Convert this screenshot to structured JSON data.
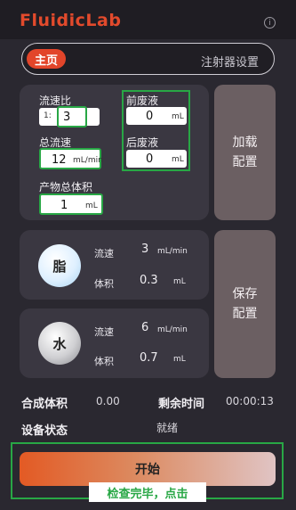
{
  "header": {
    "logo_text": "FluidicLab",
    "info_icon": "info-icon",
    "info_glyph": "i"
  },
  "tabs": {
    "main": "主页",
    "settings": "注射器设置"
  },
  "params": {
    "flow_ratio_label": "流速比",
    "flow_ratio_prefix": "1:",
    "flow_ratio_value": "3",
    "front_waste_label": "前废液",
    "front_waste_value": "0",
    "front_waste_unit": "mL",
    "total_flow_label": "总流速",
    "total_flow_value": "12",
    "total_flow_unit": "mL/min",
    "rear_waste_label": "后废液",
    "rear_waste_value": "0",
    "rear_waste_unit": "mL",
    "product_volume_label": "产物总体积",
    "product_volume_value": "1",
    "product_volume_unit": "mL"
  },
  "buttons": {
    "load_config": "加载\n配置",
    "save_config": "保存\n配置",
    "start": "开始"
  },
  "channels": {
    "lipid": {
      "name": "脂",
      "flow_label": "流速",
      "flow_value": "3",
      "flow_unit": "mL/min",
      "volume_label": "体积",
      "volume_value": "0.3",
      "volume_unit": "mL"
    },
    "water": {
      "name": "水",
      "flow_label": "流速",
      "flow_value": "6",
      "flow_unit": "mL/min",
      "volume_label": "体积",
      "volume_value": "0.7",
      "volume_unit": "mL"
    }
  },
  "status": {
    "synth_volume_label": "合成体积",
    "synth_volume_value": "0.00",
    "remaining_time_label": "剩余时间",
    "remaining_time_value": "00:00:13",
    "device_status_label": "设备状态",
    "device_status_value": "就绪"
  },
  "hint": "检查完毕，点击",
  "colors": {
    "accent": "#e2452a",
    "highlight": "#28a745",
    "background": "#2a2830"
  }
}
